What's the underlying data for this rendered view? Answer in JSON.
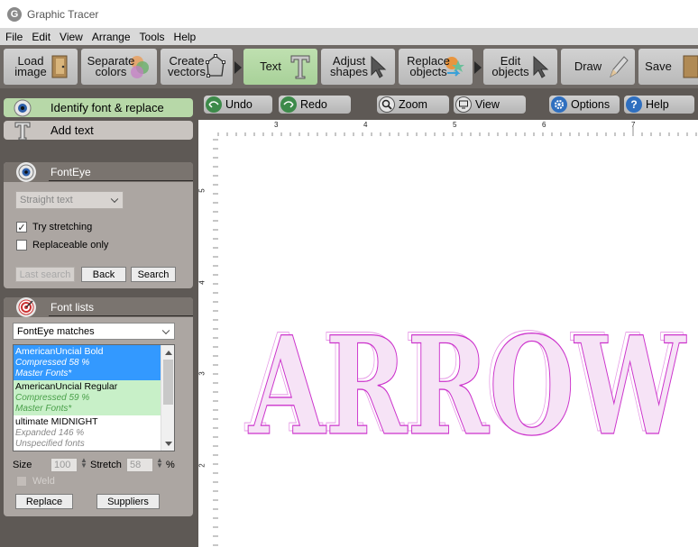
{
  "window": {
    "title": "Graphic Tracer",
    "icon_letter": "G"
  },
  "menu": [
    "File",
    "Edit",
    "View",
    "Arrange",
    "Tools",
    "Help"
  ],
  "toolbar": {
    "load_image": "Load\nimage",
    "separate_colors": "Separate\ncolors",
    "create_vectors": "Create\nvectors",
    "text": "Text",
    "adjust_shapes": "Adjust\nshapes",
    "replace_objects": "Replace\nobjects",
    "edit_objects": "Edit\nobjects",
    "draw": "Draw",
    "save": "Save"
  },
  "modes": {
    "identify": "Identify font & replace",
    "add_text": "Add text"
  },
  "fonteye": {
    "header": "FontEye",
    "text_mode": "Straight text",
    "try_stretching": "Try stretching",
    "try_stretching_checked": true,
    "replaceable_only": "Replaceable only",
    "replaceable_only_checked": false,
    "last_search": "Last search",
    "back": "Back",
    "search": "Search"
  },
  "fontlists": {
    "header": "Font lists",
    "source": "FontEye matches",
    "items": [
      {
        "name": "AmericanUncial Bold",
        "detail": "Compressed 58 %",
        "source": "Master Fonts*",
        "state": "selected"
      },
      {
        "name": "AmericanUncial Regular",
        "detail": "Compressed 59 %",
        "source": "Master Fonts*",
        "state": "match"
      },
      {
        "name": "ultimate MIDNIGHT",
        "detail": "Expanded 146 %",
        "source": "Unspecified fonts",
        "state": "plain"
      }
    ],
    "size_label": "Size",
    "size_value": "100",
    "stretch_label": "Stretch",
    "stretch_value": "58",
    "percent": "%",
    "weld": "Weld",
    "replace": "Replace",
    "suppliers": "Suppliers"
  },
  "workspace": {
    "undo": "Undo",
    "redo": "Redo",
    "zoom": "Zoom",
    "view": "View",
    "options": "Options",
    "help": "Help"
  },
  "rulers": {
    "h_labels": [
      "3",
      "4",
      "5",
      "6",
      "7"
    ],
    "v_labels": [
      "5",
      "4",
      "3",
      "2"
    ]
  },
  "canvas": {
    "text": "ARROW",
    "text_color": "#cc33cc",
    "fill_color": "#f6e3f6"
  },
  "colors": {
    "toolbar_bg": "#6f6a66",
    "panel_bg": "#5e5955",
    "active_green": "#b7d8a8",
    "selection_blue": "#3399ff",
    "match_green": "#c8f0c8"
  }
}
